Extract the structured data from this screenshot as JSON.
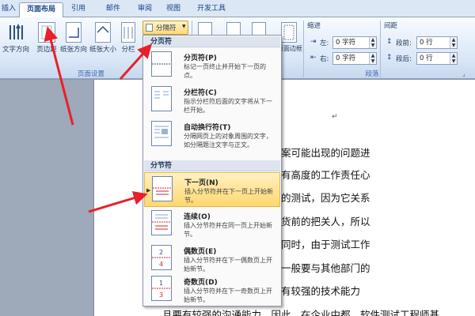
{
  "tabs": [
    {
      "label": "插入"
    },
    {
      "label": "页面布局"
    },
    {
      "label": "引用"
    },
    {
      "label": "邮件"
    },
    {
      "label": "审阅"
    },
    {
      "label": "视图"
    },
    {
      "label": "开发工具"
    }
  ],
  "ribbon": {
    "buttons": {
      "text_direction": "文字方向",
      "margins": "页边距",
      "orientation": "纸张方向",
      "size": "纸张大小",
      "columns": "分栏",
      "breaks": "分隔符",
      "page_border": "页面边框"
    },
    "page_setup_group": "页面设置",
    "indent": {
      "title": "缩进",
      "left_label": "左:",
      "left_value": "0 字符",
      "right_label": "右:",
      "right_value": "0 字符"
    },
    "spacing": {
      "title": "间距",
      "before_label": "段前:",
      "before_value": "0 行",
      "after_label": "段后:",
      "after_value": "0 行"
    },
    "paragraph_group": "段落"
  },
  "menu": {
    "page_breaks_header": "分页符",
    "section_breaks_header": "分节符",
    "items": [
      {
        "title": "分页符(P)",
        "desc": "标记一页终止并开始下一页的点。"
      },
      {
        "title": "分栏符(C)",
        "desc": "指示分栏符后面的文字将从下一栏开始。"
      },
      {
        "title": "自动换行符(T)",
        "desc": "分隔网页上的对象周围的文字，如分隔题注文字与正文。"
      },
      {
        "title": "下一页(N)",
        "desc": "插入分节符并在下一页上开始新节。"
      },
      {
        "title": "连续(O)",
        "desc": "插入分节符并在同一页上开始新节。"
      },
      {
        "title": "偶数页(E)",
        "desc": "插入分节符并在下一偶数页上开始新节。"
      },
      {
        "title": "奇数页(D)",
        "desc": "插入分节符并在下一奇数页上开始新节。"
      }
    ]
  },
  "document": {
    "lines": [
      "件测试系统，对测试方案可能出现的问题进",
      "试工程师而言，必须具有高度的工作责任心",
      "试必须是一种实事求是的测试，因为它关系",
      "测试工程师则是产品出货前的把关人，所以",
      "无法胜任这项工作的。同时，由于测试工作",
      "间完成，并且测试部门一般要与其他部门的",
      "要求测试工程师不但要有较强的技术能力",
      "且要有较强的沟通能力。因此，在企业中都，软件测试工程师基"
    ]
  },
  "colors": {
    "arrow": "#e8202a",
    "highlight": "#ffd76e",
    "ribbon_text": "#15428b"
  }
}
